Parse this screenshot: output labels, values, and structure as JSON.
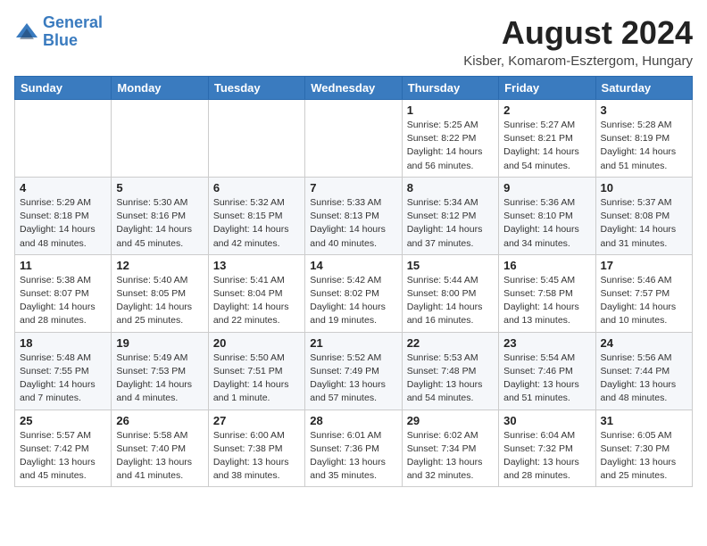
{
  "header": {
    "logo_line1": "General",
    "logo_line2": "Blue",
    "month_title": "August 2024",
    "location": "Kisber, Komarom-Esztergom, Hungary"
  },
  "days_of_week": [
    "Sunday",
    "Monday",
    "Tuesday",
    "Wednesday",
    "Thursday",
    "Friday",
    "Saturday"
  ],
  "weeks": [
    [
      {
        "day": "",
        "info": ""
      },
      {
        "day": "",
        "info": ""
      },
      {
        "day": "",
        "info": ""
      },
      {
        "day": "",
        "info": ""
      },
      {
        "day": "1",
        "info": "Sunrise: 5:25 AM\nSunset: 8:22 PM\nDaylight: 14 hours\nand 56 minutes."
      },
      {
        "day": "2",
        "info": "Sunrise: 5:27 AM\nSunset: 8:21 PM\nDaylight: 14 hours\nand 54 minutes."
      },
      {
        "day": "3",
        "info": "Sunrise: 5:28 AM\nSunset: 8:19 PM\nDaylight: 14 hours\nand 51 minutes."
      }
    ],
    [
      {
        "day": "4",
        "info": "Sunrise: 5:29 AM\nSunset: 8:18 PM\nDaylight: 14 hours\nand 48 minutes."
      },
      {
        "day": "5",
        "info": "Sunrise: 5:30 AM\nSunset: 8:16 PM\nDaylight: 14 hours\nand 45 minutes."
      },
      {
        "day": "6",
        "info": "Sunrise: 5:32 AM\nSunset: 8:15 PM\nDaylight: 14 hours\nand 42 minutes."
      },
      {
        "day": "7",
        "info": "Sunrise: 5:33 AM\nSunset: 8:13 PM\nDaylight: 14 hours\nand 40 minutes."
      },
      {
        "day": "8",
        "info": "Sunrise: 5:34 AM\nSunset: 8:12 PM\nDaylight: 14 hours\nand 37 minutes."
      },
      {
        "day": "9",
        "info": "Sunrise: 5:36 AM\nSunset: 8:10 PM\nDaylight: 14 hours\nand 34 minutes."
      },
      {
        "day": "10",
        "info": "Sunrise: 5:37 AM\nSunset: 8:08 PM\nDaylight: 14 hours\nand 31 minutes."
      }
    ],
    [
      {
        "day": "11",
        "info": "Sunrise: 5:38 AM\nSunset: 8:07 PM\nDaylight: 14 hours\nand 28 minutes."
      },
      {
        "day": "12",
        "info": "Sunrise: 5:40 AM\nSunset: 8:05 PM\nDaylight: 14 hours\nand 25 minutes."
      },
      {
        "day": "13",
        "info": "Sunrise: 5:41 AM\nSunset: 8:04 PM\nDaylight: 14 hours\nand 22 minutes."
      },
      {
        "day": "14",
        "info": "Sunrise: 5:42 AM\nSunset: 8:02 PM\nDaylight: 14 hours\nand 19 minutes."
      },
      {
        "day": "15",
        "info": "Sunrise: 5:44 AM\nSunset: 8:00 PM\nDaylight: 14 hours\nand 16 minutes."
      },
      {
        "day": "16",
        "info": "Sunrise: 5:45 AM\nSunset: 7:58 PM\nDaylight: 14 hours\nand 13 minutes."
      },
      {
        "day": "17",
        "info": "Sunrise: 5:46 AM\nSunset: 7:57 PM\nDaylight: 14 hours\nand 10 minutes."
      }
    ],
    [
      {
        "day": "18",
        "info": "Sunrise: 5:48 AM\nSunset: 7:55 PM\nDaylight: 14 hours\nand 7 minutes."
      },
      {
        "day": "19",
        "info": "Sunrise: 5:49 AM\nSunset: 7:53 PM\nDaylight: 14 hours\nand 4 minutes."
      },
      {
        "day": "20",
        "info": "Sunrise: 5:50 AM\nSunset: 7:51 PM\nDaylight: 14 hours\nand 1 minute."
      },
      {
        "day": "21",
        "info": "Sunrise: 5:52 AM\nSunset: 7:49 PM\nDaylight: 13 hours\nand 57 minutes."
      },
      {
        "day": "22",
        "info": "Sunrise: 5:53 AM\nSunset: 7:48 PM\nDaylight: 13 hours\nand 54 minutes."
      },
      {
        "day": "23",
        "info": "Sunrise: 5:54 AM\nSunset: 7:46 PM\nDaylight: 13 hours\nand 51 minutes."
      },
      {
        "day": "24",
        "info": "Sunrise: 5:56 AM\nSunset: 7:44 PM\nDaylight: 13 hours\nand 48 minutes."
      }
    ],
    [
      {
        "day": "25",
        "info": "Sunrise: 5:57 AM\nSunset: 7:42 PM\nDaylight: 13 hours\nand 45 minutes."
      },
      {
        "day": "26",
        "info": "Sunrise: 5:58 AM\nSunset: 7:40 PM\nDaylight: 13 hours\nand 41 minutes."
      },
      {
        "day": "27",
        "info": "Sunrise: 6:00 AM\nSunset: 7:38 PM\nDaylight: 13 hours\nand 38 minutes."
      },
      {
        "day": "28",
        "info": "Sunrise: 6:01 AM\nSunset: 7:36 PM\nDaylight: 13 hours\nand 35 minutes."
      },
      {
        "day": "29",
        "info": "Sunrise: 6:02 AM\nSunset: 7:34 PM\nDaylight: 13 hours\nand 32 minutes."
      },
      {
        "day": "30",
        "info": "Sunrise: 6:04 AM\nSunset: 7:32 PM\nDaylight: 13 hours\nand 28 minutes."
      },
      {
        "day": "31",
        "info": "Sunrise: 6:05 AM\nSunset: 7:30 PM\nDaylight: 13 hours\nand 25 minutes."
      }
    ]
  ]
}
